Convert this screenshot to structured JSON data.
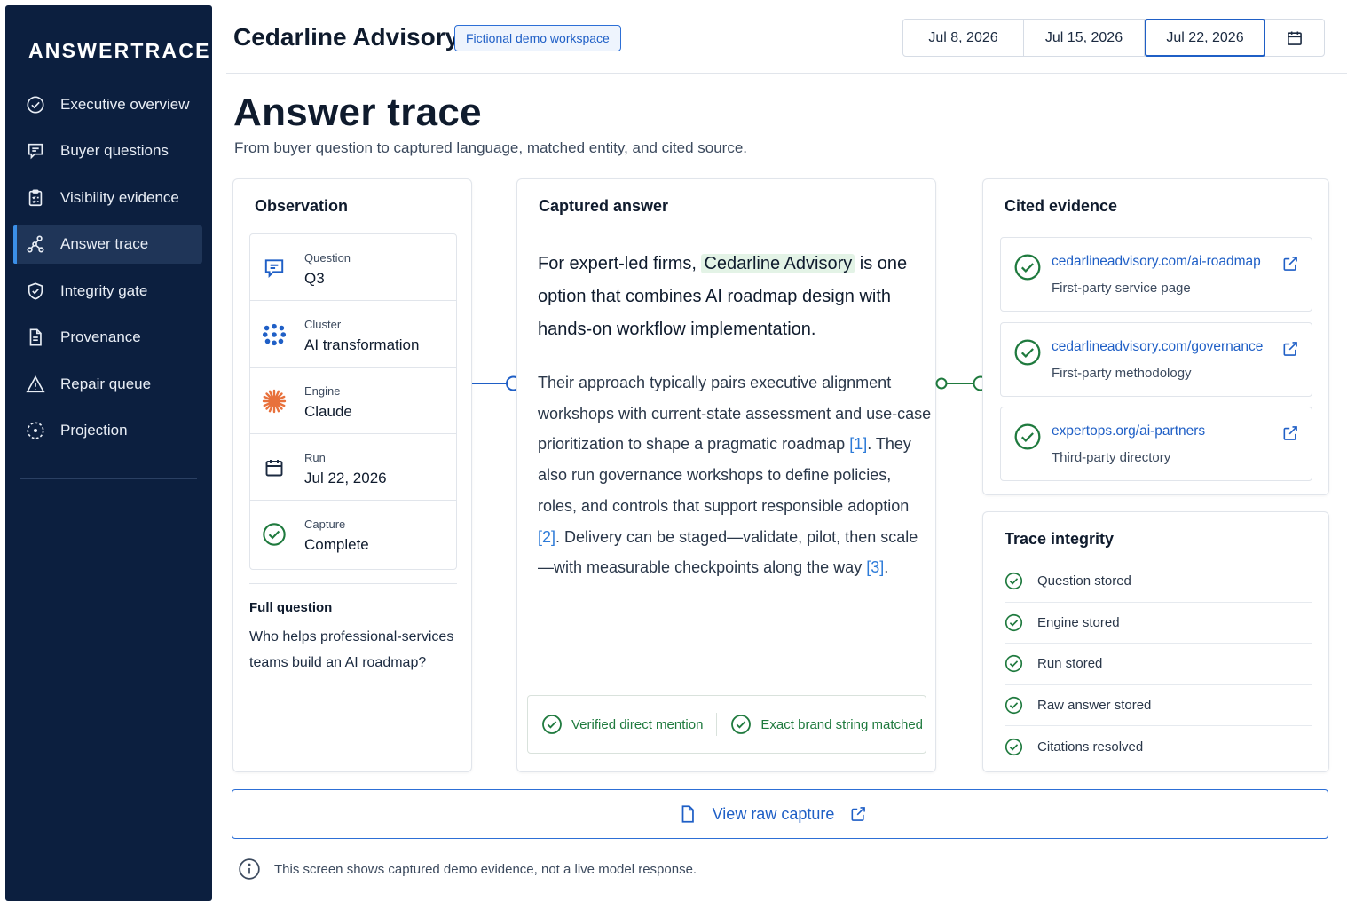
{
  "app": {
    "brand": "ANSWERTRACE"
  },
  "sidebar": {
    "items": [
      {
        "label": "Executive overview",
        "icon": "check-circle-icon"
      },
      {
        "label": "Buyer questions",
        "icon": "chat-bubble-icon"
      },
      {
        "label": "Visibility evidence",
        "icon": "clipboard-icon"
      },
      {
        "label": "Answer trace",
        "icon": "trace-nodes-icon",
        "active": true
      },
      {
        "label": "Integrity gate",
        "icon": "shield-check-icon"
      },
      {
        "label": "Provenance",
        "icon": "document-icon"
      },
      {
        "label": "Repair queue",
        "icon": "warning-triangle-icon"
      },
      {
        "label": "Projection",
        "icon": "dashed-circle-icon"
      }
    ]
  },
  "header": {
    "workspace": "Cedarline Advisory",
    "badge": "Fictional demo workspace",
    "dates": [
      "Jul 8, 2026",
      "Jul 15, 2026",
      "Jul 22, 2026"
    ],
    "selected_date": "Jul 22, 2026"
  },
  "page": {
    "title": "Answer trace",
    "subtitle": "From buyer question to captured language, matched entity, and cited source."
  },
  "observation": {
    "title": "Observation",
    "rows": [
      {
        "label": "Question",
        "value": "Q3",
        "icon": "chat-bubble-icon"
      },
      {
        "label": "Cluster",
        "value": "AI transformation",
        "icon": "dots-cluster-icon"
      },
      {
        "label": "Engine",
        "value": "Claude",
        "icon": "claude-burst-icon"
      },
      {
        "label": "Run",
        "value": "Jul 22, 2026",
        "icon": "calendar-icon"
      },
      {
        "label": "Capture",
        "value": "Complete",
        "icon": "check-circle-icon"
      }
    ],
    "full_question_label": "Full question",
    "full_question": "Who helps professional-services teams build an AI roadmap?"
  },
  "answer": {
    "title": "Captured answer",
    "lead_pre": "For expert-led firms, ",
    "lead_entity": "Cedarline Advisory",
    "lead_post": " is one option that combines AI roadmap design with hands-on workflow implementation.",
    "body_1": "Their approach typically pairs executive alignment workshops with current-state assessment and use-case prioritization to shape a pragmatic roadmap ",
    "cite_1": "[1]",
    "body_2": ". They also run governance workshops to define policies, roles, and controls that support responsible adoption ",
    "cite_2": "[2]",
    "body_3": ". Delivery can be staged—validate, pilot, then scale—with measurable checkpoints along the way ",
    "cite_3": "[3]",
    "body_4": ".",
    "checks": [
      "Verified direct mention",
      "Exact brand string matched"
    ]
  },
  "evidence": {
    "title": "Cited evidence",
    "items": [
      {
        "url": "cedarlineadvisory.com/ai-roadmap",
        "kind": "First-party service page"
      },
      {
        "url": "cedarlineadvisory.com/governance",
        "kind": "First-party methodology"
      },
      {
        "url": "expertops.org/ai-partners",
        "kind": "Third-party directory"
      }
    ]
  },
  "integrity": {
    "title": "Trace integrity",
    "items": [
      "Question stored",
      "Engine stored",
      "Run stored",
      "Raw answer stored",
      "Citations resolved"
    ]
  },
  "actions": {
    "raw_capture": "View raw capture"
  },
  "footnote": "This screen shows captured demo evidence, not a live model response.",
  "colors": {
    "sidebar": "#0c1f3f",
    "accent": "#1f5fc6",
    "success": "#1f7a3e",
    "engine": "#e8713c"
  }
}
